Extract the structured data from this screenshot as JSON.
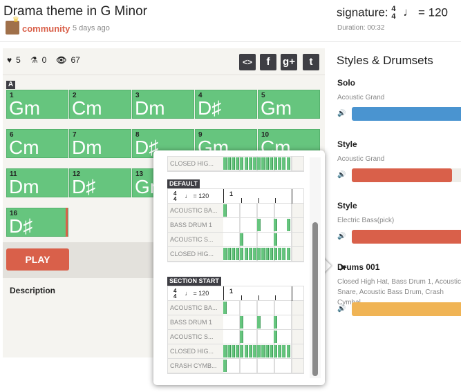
{
  "header": {
    "title": "Drama theme in G Minor",
    "author": "community",
    "posted": "5 days ago",
    "signature_label": "signature:",
    "sig_top": "4",
    "sig_bottom": "4",
    "tempo": "= 120",
    "duration": "Duration: 00:32"
  },
  "stats": {
    "likes": "5",
    "forks": "0",
    "views": "67"
  },
  "share": {
    "embed": "<>",
    "facebook": "f",
    "googleplus": "g+",
    "twitter": "t"
  },
  "section": "A",
  "chords": [
    {
      "n": "1",
      "c": "Gm"
    },
    {
      "n": "2",
      "c": "Cm"
    },
    {
      "n": "3",
      "c": "Dm"
    },
    {
      "n": "4",
      "c": "D♯"
    },
    {
      "n": "5",
      "c": "Gm"
    },
    {
      "n": "6",
      "c": "Cm"
    },
    {
      "n": "7",
      "c": "Dm"
    },
    {
      "n": "8",
      "c": "D♯"
    },
    {
      "n": "9",
      "c": "Gm"
    },
    {
      "n": "10",
      "c": "Cm"
    },
    {
      "n": "11",
      "c": "Dm"
    },
    {
      "n": "12",
      "c": "D♯"
    },
    {
      "n": "13",
      "c": "Gm"
    },
    {
      "n": "16",
      "c": "D♯"
    }
  ],
  "play_label": "PLAY",
  "description_label": "Description",
  "popup": {
    "partial_row": {
      "label": "CLOSED HIG...",
      "hits": [
        1,
        2,
        3,
        4,
        5,
        6,
        7,
        8,
        9,
        10,
        11,
        12,
        13,
        14,
        15,
        16
      ]
    },
    "patterns": [
      {
        "name": "DEFAULT",
        "sig_top": "4",
        "sig_bottom": "4",
        "tempo": "= 120",
        "bar": "1",
        "rows": [
          {
            "label": "ACOUSTIC BA...",
            "hits": [
              1
            ]
          },
          {
            "label": "BASS DRUM 1",
            "hits": [
              9,
              13,
              16
            ]
          },
          {
            "label": "ACOUSTIC S...",
            "hits": [
              5,
              13
            ]
          },
          {
            "label": "CLOSED HIG...",
            "hits": [
              1,
              2,
              3,
              4,
              5,
              6,
              7,
              8,
              9,
              10,
              11,
              12,
              13,
              14,
              15,
              16
            ]
          }
        ]
      },
      {
        "name": "SECTION START",
        "sig_top": "4",
        "sig_bottom": "4",
        "tempo": "= 120",
        "bar": "1",
        "rows": [
          {
            "label": "ACOUSTIC BA...",
            "hits": [
              1
            ]
          },
          {
            "label": "BASS DRUM 1",
            "hits": [
              5,
              9,
              13
            ]
          },
          {
            "label": "ACOUSTIC S...",
            "hits": [
              5,
              13
            ]
          },
          {
            "label": "CLOSED HIG...",
            "hits": [
              1,
              2,
              3,
              4,
              5,
              6,
              7,
              8,
              9,
              10,
              11,
              12,
              13,
              14,
              15,
              16
            ]
          },
          {
            "label": "CRASH CYMB...",
            "hits": [
              1
            ]
          }
        ]
      }
    ]
  },
  "styles": {
    "title": "Styles & Drumsets",
    "items": [
      {
        "name": "Solo",
        "sub": "Acoustic Grand",
        "color": "#4a94d0",
        "level": 100
      },
      {
        "name": "Style",
        "sub": "Acoustic Grand",
        "color": "#d9604a",
        "level": 85
      },
      {
        "name": "Style",
        "sub": "Electric Bass(pick)",
        "color": "#d9604a",
        "level": 100
      },
      {
        "name": "Drums 001",
        "sub": "Closed High Hat, Bass Drum 1, Acoustic Snare, Acoustic Bass Drum, Crash Cymbal",
        "color": "#f0b455",
        "level": 100
      }
    ]
  }
}
